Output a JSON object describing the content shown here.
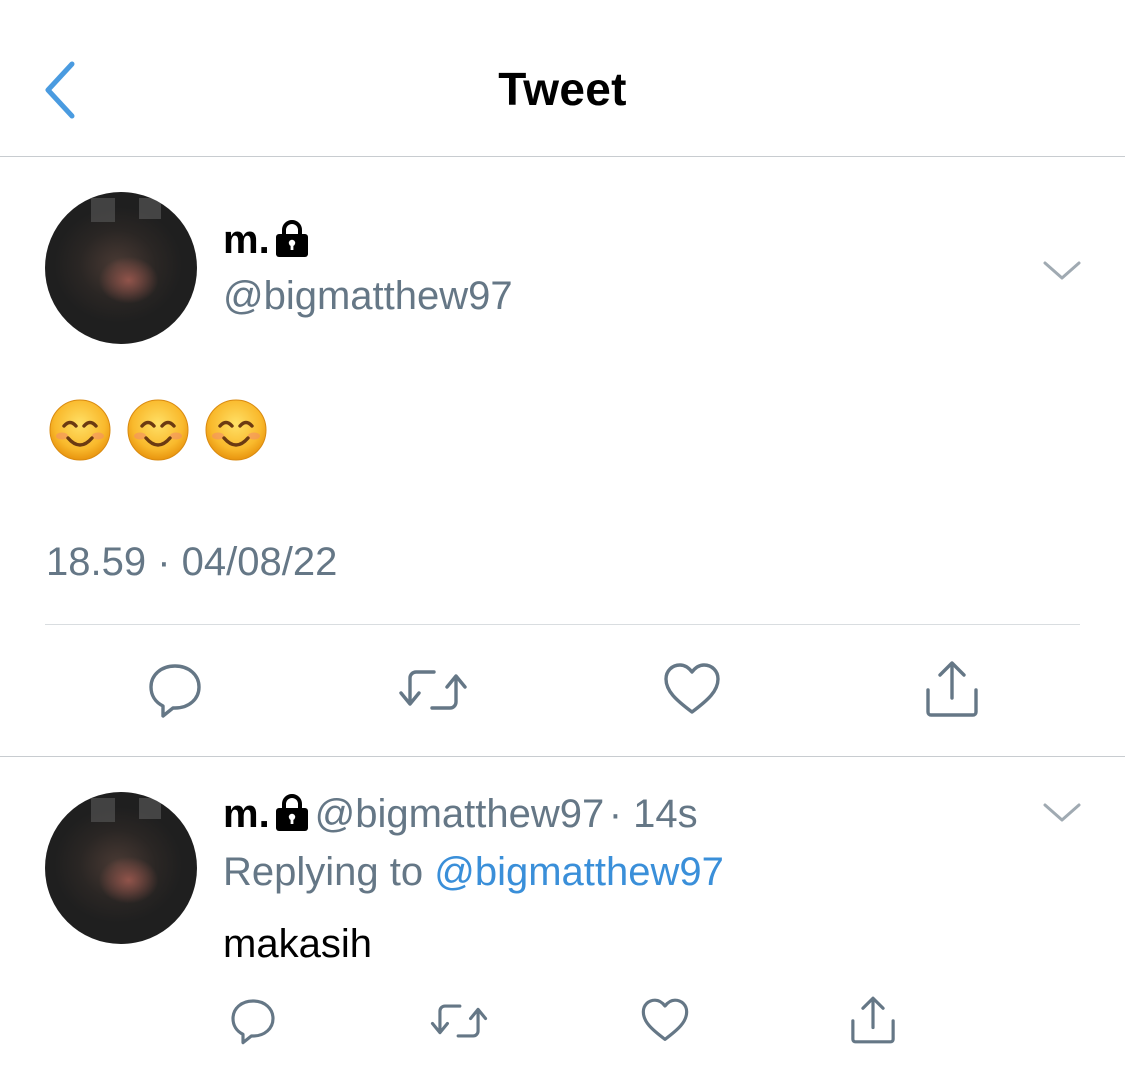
{
  "header": {
    "title": "Tweet",
    "back_icon": "chevron-left-icon",
    "accent_color": "#4a9be0"
  },
  "main_tweet": {
    "name": "m.",
    "handle": "@bigmatthew97",
    "locked": true,
    "content_emoji": [
      "smiling-face-with-smiling-eyes",
      "smiling-face-with-smiling-eyes",
      "smiling-face-with-smiling-eyes"
    ],
    "timestamp": "18.59 · 04/08/22",
    "actions": [
      "reply-icon",
      "retweet-icon",
      "like-icon",
      "share-icon"
    ]
  },
  "reply_tweet": {
    "name": "m.",
    "handle": "@bigmatthew97",
    "time": "· 14s",
    "replying_label": "Replying to",
    "replying_to": "@bigmatthew97",
    "text": "makasih",
    "actions": [
      "reply-icon",
      "retweet-icon",
      "like-icon",
      "share-icon"
    ]
  },
  "colors": {
    "text_primary": "#000000",
    "text_secondary": "#657786",
    "link": "#3a8fd9",
    "divider": "#c8ccd0"
  }
}
